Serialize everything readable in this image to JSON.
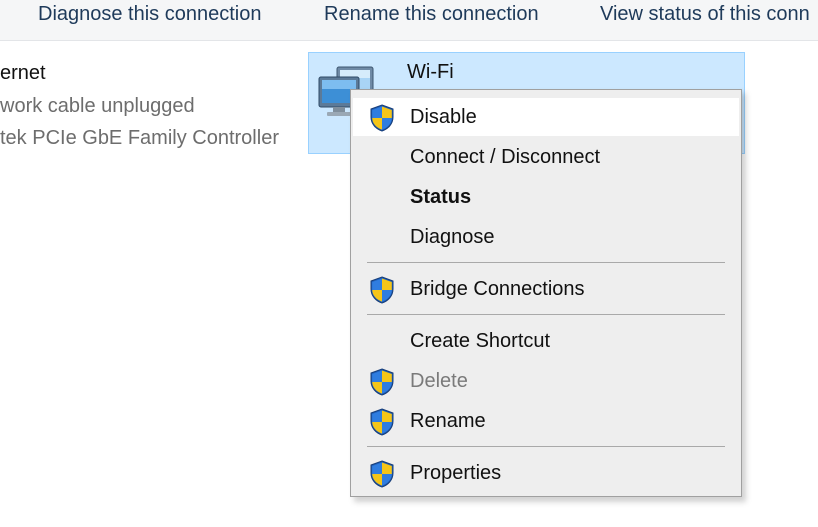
{
  "command_bar": {
    "diagnose": "Diagnose this connection",
    "rename": "Rename this connection",
    "view_status": "View status of this conn"
  },
  "ethernet": {
    "name": "ernet",
    "status": "work cable unplugged",
    "device": "tek PCIe GbE Family Controller"
  },
  "wifi": {
    "name": "Wi-Fi",
    "icon": "network-adapter-icon"
  },
  "context_menu": {
    "items": [
      {
        "label": "Disable",
        "shield": true,
        "hovered": true
      },
      {
        "label": "Connect / Disconnect",
        "shield": false
      },
      {
        "label": "Status",
        "shield": false,
        "bold": true
      },
      {
        "label": "Diagnose",
        "shield": false
      },
      {
        "label": "Bridge Connections",
        "shield": true
      },
      {
        "label": "Create Shortcut",
        "shield": false
      },
      {
        "label": "Delete",
        "shield": true,
        "disabled": true
      },
      {
        "label": "Rename",
        "shield": true
      },
      {
        "label": "Properties",
        "shield": true
      }
    ],
    "shield_icon": "uac-shield-icon"
  },
  "colors": {
    "selection_bg": "#cce8ff",
    "selection_border": "#99d1ff",
    "menu_bg": "#eeeeee",
    "command_text": "#1e3a5a"
  }
}
